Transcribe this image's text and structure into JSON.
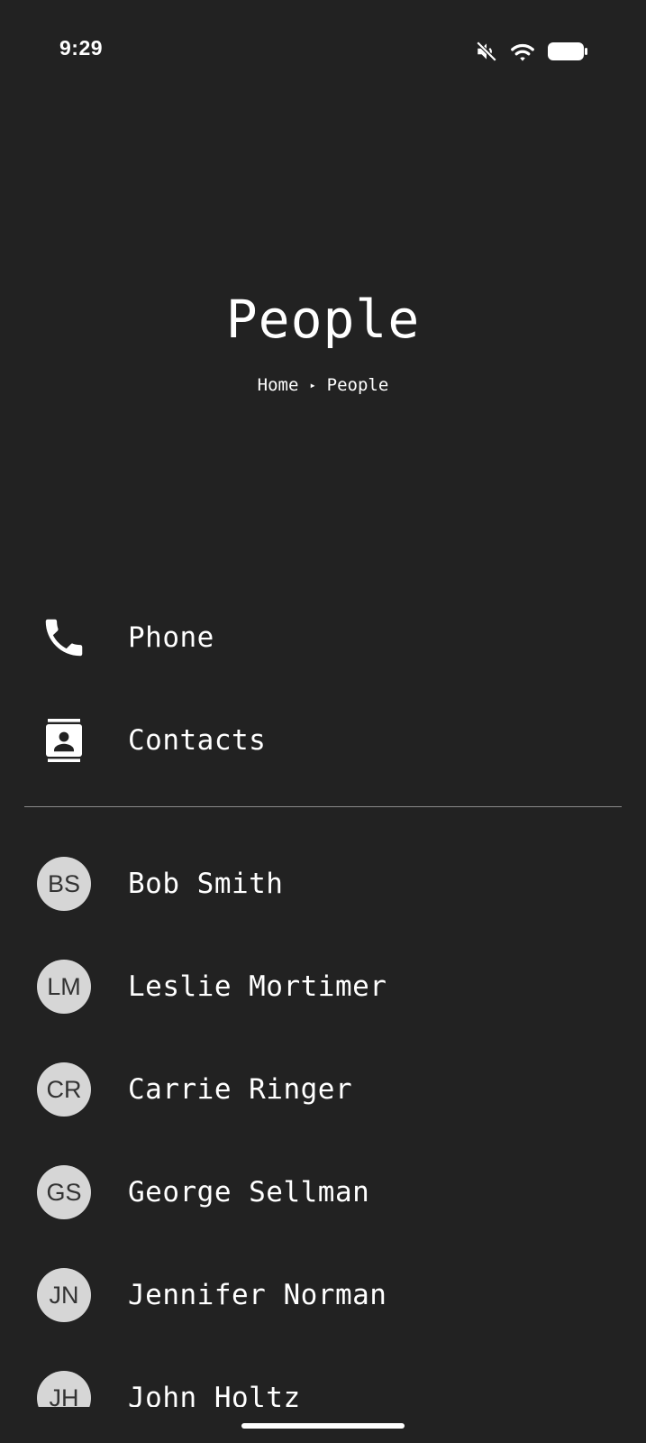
{
  "status_bar": {
    "time": "9:29",
    "icons": [
      "mute-icon",
      "wifi-icon",
      "battery-icon"
    ]
  },
  "header": {
    "title": "People",
    "breadcrumb": {
      "home": "Home",
      "separator": "▸",
      "current": "People"
    }
  },
  "actions": [
    {
      "label": "Phone",
      "icon": "phone-icon"
    },
    {
      "label": "Contacts",
      "icon": "contacts-icon"
    }
  ],
  "people": [
    {
      "initials": "BS",
      "name": "Bob Smith"
    },
    {
      "initials": "LM",
      "name": "Leslie Mortimer"
    },
    {
      "initials": "CR",
      "name": "Carrie Ringer"
    },
    {
      "initials": "GS",
      "name": "George Sellman"
    },
    {
      "initials": "JN",
      "name": "Jennifer Norman"
    },
    {
      "initials": "JH",
      "name": "John Holtz"
    }
  ],
  "colors": {
    "background": "#222222",
    "text": "#ffffff",
    "avatar_bg": "#d6d6d6",
    "avatar_text": "#333333",
    "divider": "#8a8a8a"
  }
}
